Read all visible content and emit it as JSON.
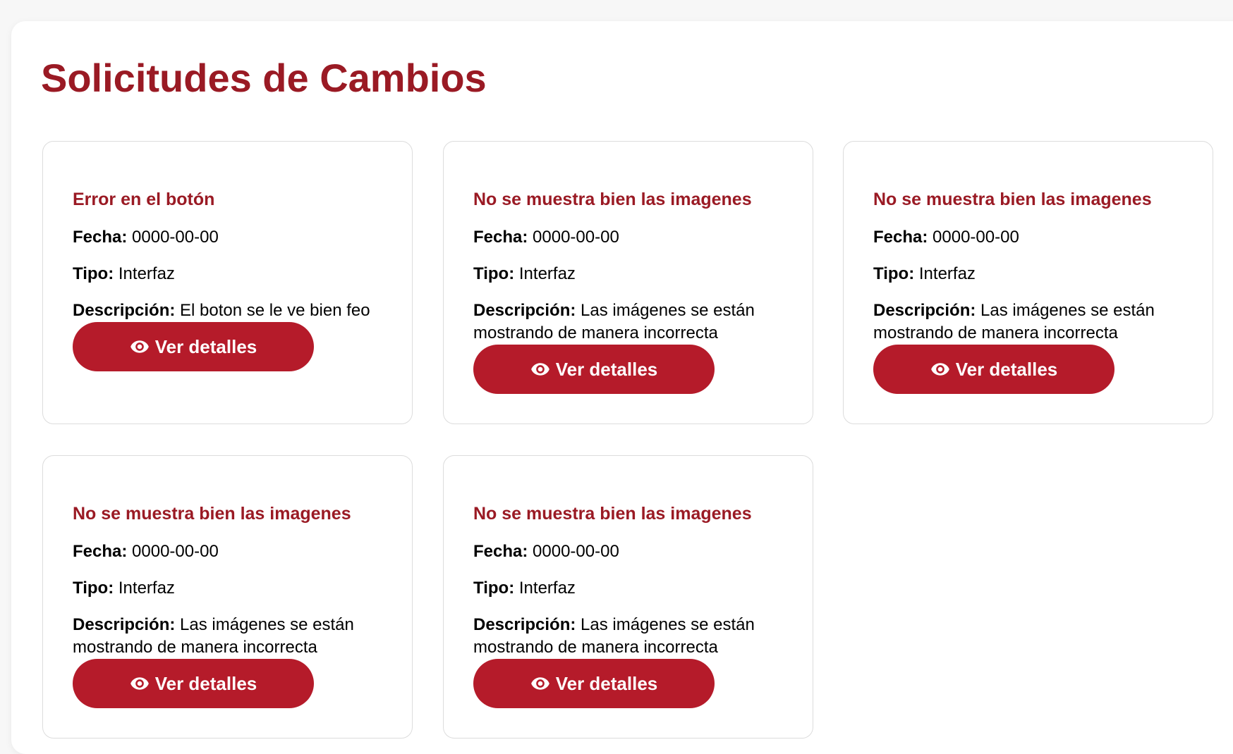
{
  "page": {
    "title": "Solicitudes de Cambios"
  },
  "labels": {
    "fecha": "Fecha:",
    "tipo": "Tipo:",
    "descripcion": "Descripción:",
    "button": "Ver detalles"
  },
  "requests": [
    {
      "title": "Error en el botón",
      "fecha": "0000-00-00",
      "tipo": "Interfaz",
      "descripcion": "El boton se le ve bien feo"
    },
    {
      "title": "No se muestra bien las imagenes",
      "fecha": "0000-00-00",
      "tipo": "Interfaz",
      "descripcion": "Las imágenes se están mostrando de manera incorrecta"
    },
    {
      "title": "No se muestra bien las imagenes",
      "fecha": "0000-00-00",
      "tipo": "Interfaz",
      "descripcion": "Las imágenes se están mostrando de manera incorrecta"
    },
    {
      "title": "No se muestra bien las imagenes",
      "fecha": "0000-00-00",
      "tipo": "Interfaz",
      "descripcion": "Las imágenes se están mostrando de manera incorrecta"
    },
    {
      "title": "No se muestra bien las imagenes",
      "fecha": "0000-00-00",
      "tipo": "Interfaz",
      "descripcion": "Las imágenes se están mostrando de manera incorrecta"
    }
  ],
  "colors": {
    "title": "#9a1a24",
    "button": "#b51b2a",
    "background": "#f7f7f7"
  },
  "icons": {
    "button_icon": "eye-icon"
  }
}
